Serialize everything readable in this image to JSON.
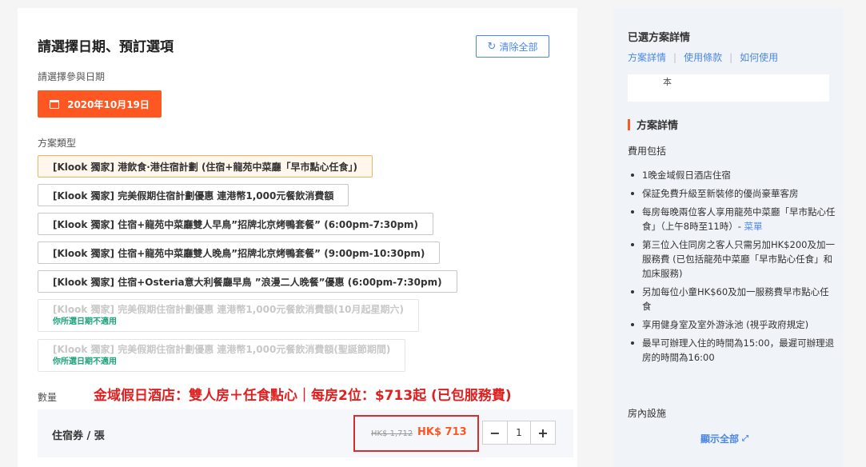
{
  "booking": {
    "title": "請選擇日期、預訂選項",
    "clear_all": "清除全部",
    "date_label": "請選擇參與日期",
    "selected_date": "2020年10月19日",
    "package_type_label": "方案類型",
    "packages": [
      {
        "text": "[Klook 獨家] 港飲食·港住宿計劃 (住宿+龍苑中菜廳「早市點心任食」)",
        "state": "selected"
      },
      {
        "text": "[Klook 獨家] 完美假期住宿計劃優惠 連港幣1,000元餐飲消費額",
        "state": "available"
      },
      {
        "text": "[Klook 獨家] 住宿+龍苑中菜廳雙人早鳥”招牌北京烤鴨套餐” (6:00pm-7:30pm)",
        "state": "available"
      },
      {
        "text": "[Klook 獨家] 住宿+龍苑中菜廳雙人晚鳥”招牌北京烤鴨套餐” (9:00pm-10:30pm)",
        "state": "available"
      },
      {
        "text": "[Klook 獨家] 住宿+Osteria意大利餐廳早鳥 ”浪漫二人晚餐”優惠 (6:00pm-7:30pm)",
        "state": "available"
      }
    ],
    "disabled_packages": [
      {
        "text": "[Klook 獨家] 完美假期住宿計劃優惠 連港幣1,000元餐飲消費額(10月起星期六)",
        "note": "你所選日期不適用"
      },
      {
        "text": "[Klook 獨家] 完美假期住宿計劃優惠 連港幣1,000元餐飲消費額(聖誕節期間)",
        "note": "你所選日期不適用"
      }
    ],
    "promo_overlay": "金域假日酒店：雙人房＋任食點心｜每房2位：$713起 (已包服務費)",
    "quantity_label": "數量",
    "item": {
      "name": "住宿券 / 張",
      "original_price": "HK$ 1,712",
      "price": "HK$ 713",
      "quantity": "1",
      "minus": "−",
      "plus": "+"
    }
  },
  "sidebar": {
    "title": "已選方案詳情",
    "links": [
      "方案詳情",
      "使用條款",
      "如何使用"
    ],
    "box_text": "本",
    "section_title": "方案詳情",
    "fee_label": "費用包括",
    "fee_items": [
      {
        "text": "1晚金域假日酒店住宿"
      },
      {
        "text": "保証免費升級至新裝修的優尚豪華客房"
      },
      {
        "text": "每房每晚兩位客人享用龍苑中菜廳「早市點心任食」（上午8時至11時）- ",
        "link": "菜單"
      },
      {
        "text": "第三位入住同房之客人只需另加HK$200及加一服務費 (已包括龍苑中菜廳「早市點心任食」和加床服務)"
      },
      {
        "text": "另加每位小童HK$60及加一服務費早市點心任食"
      },
      {
        "text": "享用健身室及室外游泳池 (視乎政府規定)"
      },
      {
        "text": "最早可辦理入住的時間為15:00，最遲可辦理退房的時間為16:00"
      }
    ],
    "room_facilities": "房內設施",
    "show_all": "顯示全部"
  },
  "icons": {
    "refresh": "refresh-icon",
    "calendar": "calendar-icon",
    "expand": "expand-icon"
  },
  "colors": {
    "accent": "#ff5722",
    "link": "#4c87e6",
    "promo_red": "#e02020",
    "available_green": "#1aa17a"
  }
}
